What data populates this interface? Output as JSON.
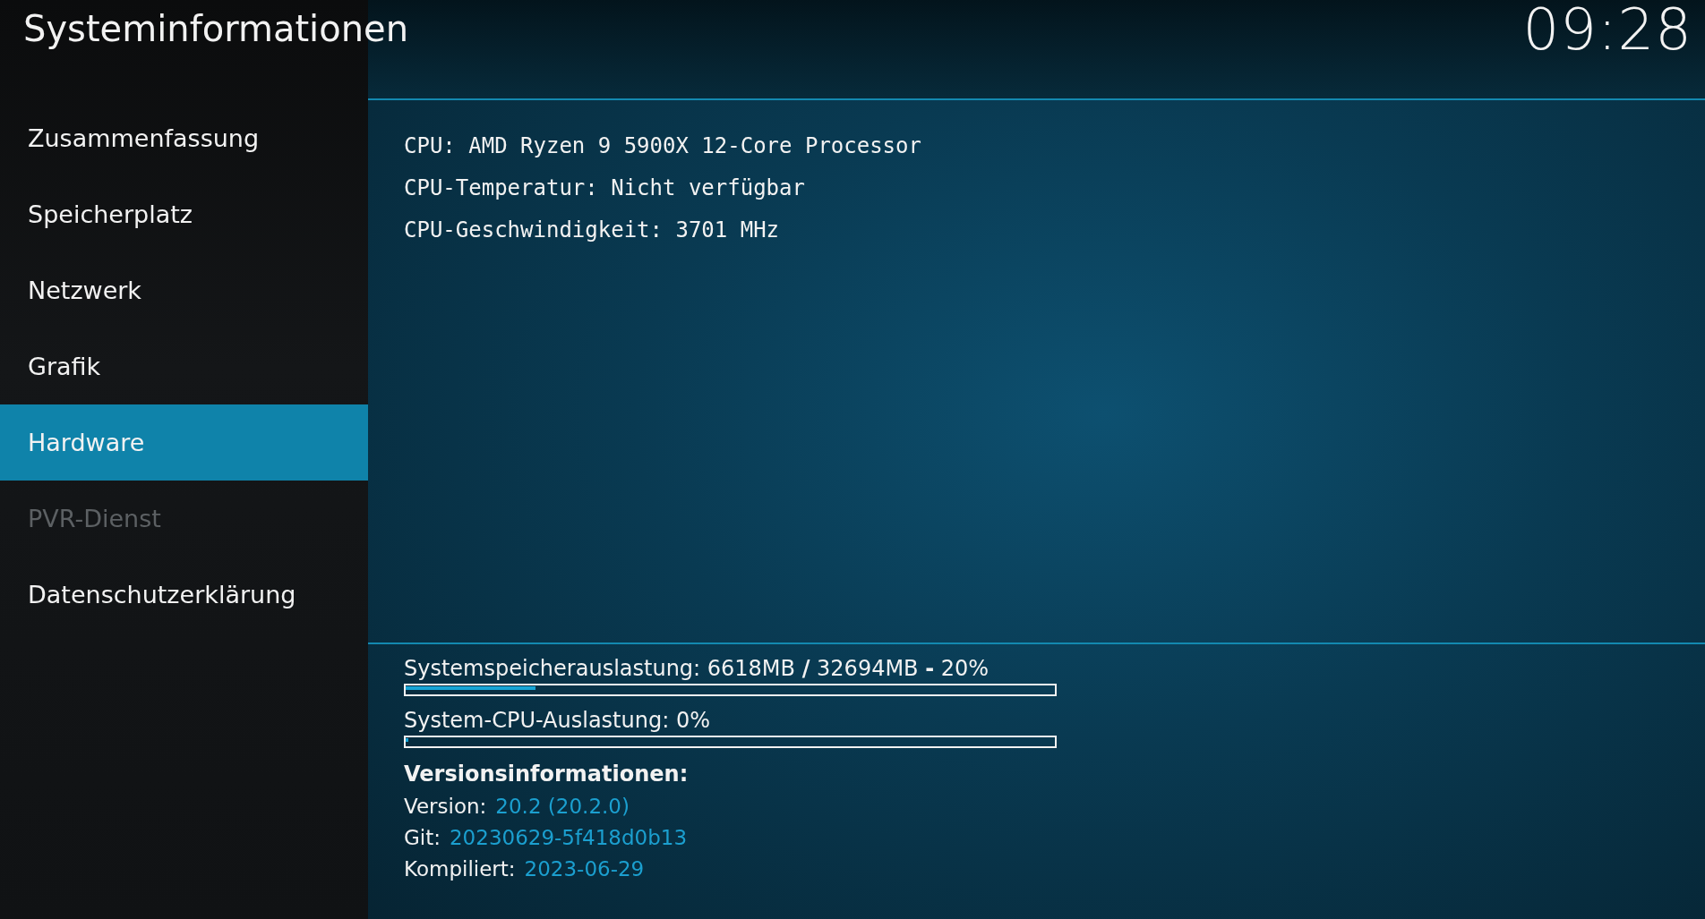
{
  "window": {
    "title": "Systeminformationen",
    "clock": "09:28"
  },
  "sidebar": {
    "items": [
      {
        "label": "Zusammenfassung",
        "selected": false,
        "disabled": false
      },
      {
        "label": "Speicherplatz",
        "selected": false,
        "disabled": false
      },
      {
        "label": "Netzwerk",
        "selected": false,
        "disabled": false
      },
      {
        "label": "Grafik",
        "selected": false,
        "disabled": false
      },
      {
        "label": "Hardware",
        "selected": true,
        "disabled": false
      },
      {
        "label": "PVR-Dienst",
        "selected": false,
        "disabled": true
      },
      {
        "label": "Datenschutzerklärung",
        "selected": false,
        "disabled": false
      }
    ]
  },
  "hardware_info": [
    "CPU: AMD Ryzen 9 5900X 12-Core Processor",
    "CPU-Temperatur: Nicht verfügbar",
    "CPU-Geschwindigkeit: 3701 MHz"
  ],
  "usage": [
    {
      "label": "Systemspeicherauslastung: 6618MB **/** 32694MB **-** 20%",
      "level": 0.2
    },
    {
      "label": "System-CPU-Auslastung: 0%",
      "level": 0.0
    }
  ],
  "version_info": {
    "heading": "Versionsinformationen:",
    "rows": [
      {
        "label": "Version:",
        "value": "20.2 (20.2.0)"
      },
      {
        "label": "Git:",
        "value": "20230629-5f418d0b13"
      },
      {
        "label": "Kompiliert:",
        "value": "2023-06-29"
      }
    ]
  }
}
